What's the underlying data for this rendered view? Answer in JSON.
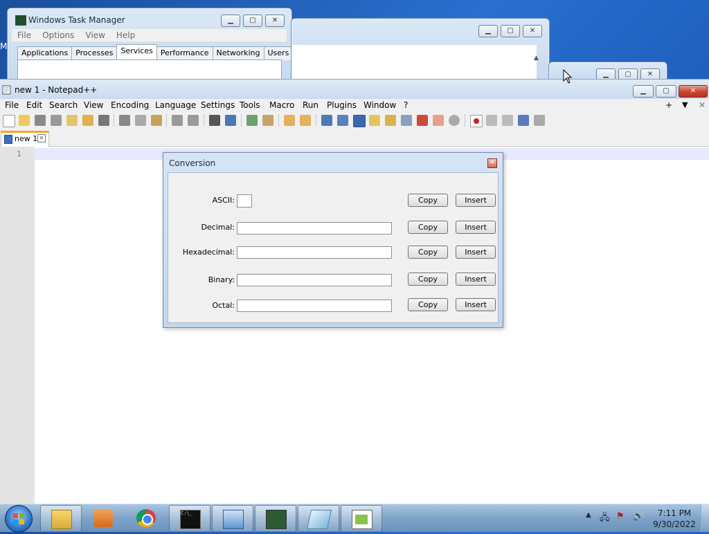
{
  "task_manager": {
    "title": "Windows Task Manager",
    "menu": [
      "File",
      "Options",
      "View",
      "Help"
    ],
    "tabs": [
      "Applications",
      "Processes",
      "Services",
      "Performance",
      "Networking",
      "Users"
    ],
    "active_tab": "Services"
  },
  "desktop_partial_text": "M",
  "notepad": {
    "title": "new 1 - Notepad++",
    "menu": [
      "File",
      "Edit",
      "Search",
      "View",
      "Encoding",
      "Language",
      "Settings",
      "Tools",
      "Macro",
      "Run",
      "Plugins",
      "Window",
      "?"
    ],
    "menu_right": [
      "+",
      "▼",
      "✕"
    ],
    "tab_label": "new 1",
    "line_numbers": [
      "1"
    ]
  },
  "conversion_dialog": {
    "title": "Conversion",
    "rows": [
      {
        "label": "ASCII:",
        "value": ""
      },
      {
        "label": "Decimal:",
        "value": ""
      },
      {
        "label": "Hexadecimal:",
        "value": ""
      },
      {
        "label": "Binary:",
        "value": ""
      },
      {
        "label": "Octal:",
        "value": ""
      }
    ],
    "copy_label": "Copy",
    "insert_label": "Insert"
  },
  "taskbar": {
    "clock_time": "7:11 PM",
    "clock_date": "9/30/2022",
    "pinned": [
      "windows-explorer-icon",
      "media-player-icon",
      "chrome-icon",
      "cmd-icon",
      "control-panel-icon",
      "task-manager-icon",
      "notepad-icon",
      "notepad-plus-plus-icon"
    ]
  },
  "colors": {
    "desktop_blue": "#1f5fb8",
    "taskbar": "#7fa3c8",
    "close_red": "#c94634",
    "active_tab_accent": "#f5a623"
  }
}
